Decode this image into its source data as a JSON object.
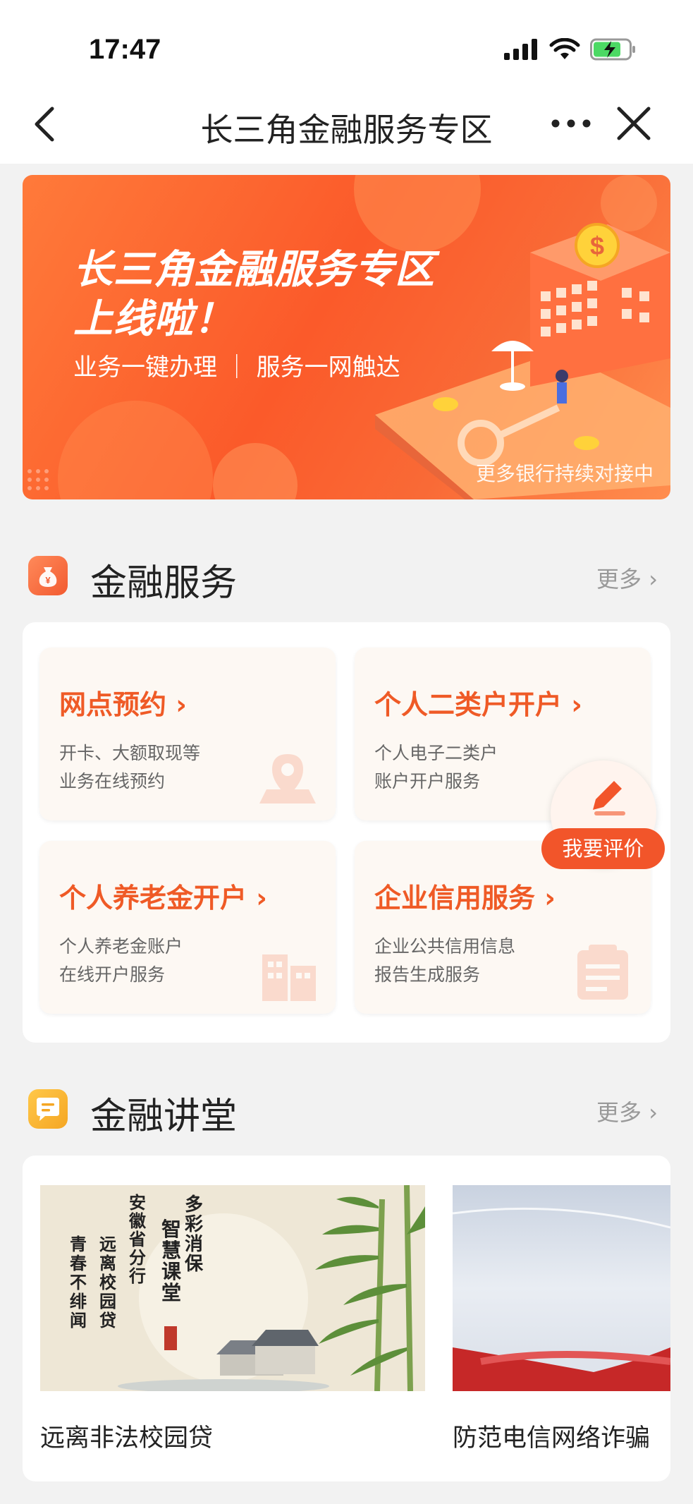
{
  "status_bar": {
    "time": "17:47"
  },
  "nav": {
    "title": "长三角金融服务专区"
  },
  "banner": {
    "title_line1": "长三角金融服务专区",
    "title_line2": "上线啦！",
    "subtitle": "业务一键办理 ｜ 服务一网触达",
    "footer": "更多银行持续对接中"
  },
  "finance_services": {
    "title": "金融服务",
    "more": "更多",
    "items": [
      {
        "title": "网点预约",
        "desc1": "开卡、大额取现等",
        "desc2": "业务在线预约"
      },
      {
        "title": "个人二类户开户",
        "desc1": "个人电子二类户",
        "desc2": "账户开户服务"
      },
      {
        "title": "个人养老金开户",
        "desc1": "个人养老金账户",
        "desc2": "在线开户服务"
      },
      {
        "title": "企业信用服务",
        "desc1": "企业公共信用信息",
        "desc2": "报告生成服务"
      }
    ]
  },
  "rate_button": {
    "label": "我要评价"
  },
  "finance_class": {
    "title": "金融讲堂",
    "more": "更多",
    "items": [
      {
        "caption": "远离非法校园贷",
        "poster_text": [
          "多彩消保",
          "智慧课堂",
          "安徽省分行",
          "远离校园贷",
          "青春不绯闻"
        ]
      },
      {
        "caption": "防范电信网络诈骗"
      }
    ]
  },
  "colors": {
    "accent": "#ef5a26",
    "banner": "#fb5a2a",
    "card_bg": "#fdf8f3",
    "page_bg": "#f2f2f2"
  },
  "icons": [
    "back-arrow-icon",
    "more-dots-icon",
    "close-icon",
    "money-bag-icon",
    "chat-bubble-icon",
    "pencil-icon",
    "signal-icon",
    "wifi-icon",
    "battery-icon"
  ]
}
